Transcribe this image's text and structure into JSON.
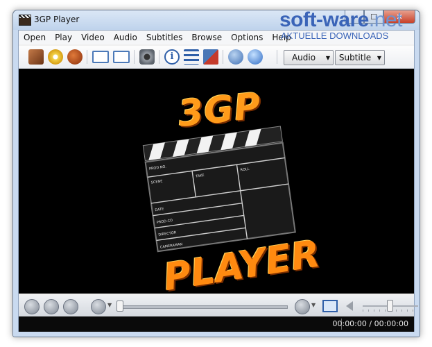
{
  "window": {
    "title": "3GP Player"
  },
  "window_buttons": {
    "minimize": "—",
    "maximize": "☐",
    "close": "✕"
  },
  "menu": [
    "Open",
    "Play",
    "Video",
    "Audio",
    "Subtitles",
    "Browse",
    "Options",
    "Help"
  ],
  "toolbar": {
    "audio_label": "Audio",
    "subtitle_label": "Subtitle",
    "icons": [
      "open-file-icon",
      "open-disc-icon",
      "open-url-icon",
      "window-icon",
      "fullscreen-icon",
      "screenshot-icon",
      "info-icon",
      "playlist-icon",
      "preferences-icon",
      "home-icon",
      "help-globe-icon"
    ]
  },
  "video": {
    "logo_top": "3GP",
    "logo_bottom": "PLAYER",
    "slate_labels": [
      "PROD NO.",
      "SCENE",
      "TAKE",
      "ROLL",
      "DATE",
      "PROD.CO",
      "DIRECTOR",
      "CAMERAMAN"
    ]
  },
  "playback": {
    "progress": 0.0,
    "volume": 0.7
  },
  "status": {
    "time": "00:00:00 / 00:00:00"
  },
  "watermark": {
    "main": "soft-ware",
    "suffix": ".net",
    "sub": "AKTUELLE DOWNLOADS"
  }
}
